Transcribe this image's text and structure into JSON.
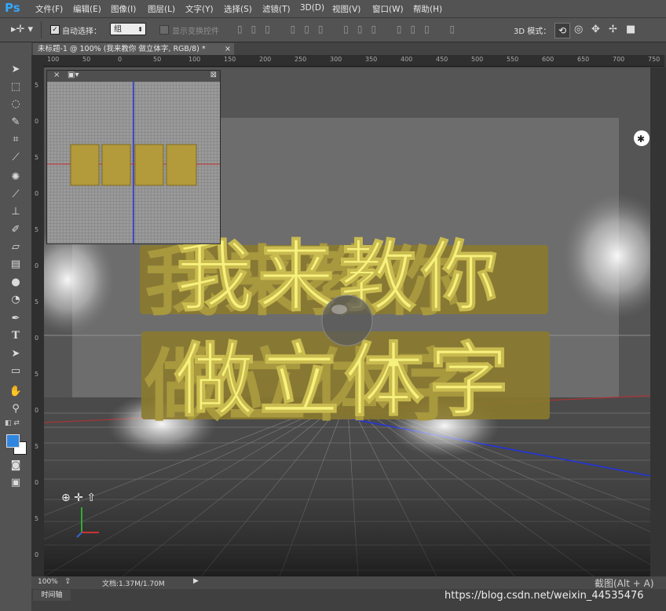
{
  "app": {
    "logo": "Ps"
  },
  "menus": [
    "文件(F)",
    "编辑(E)",
    "图像(I)",
    "图层(L)",
    "文字(Y)",
    "选择(S)",
    "滤镜(T)",
    "3D(D)",
    "视图(V)",
    "窗口(W)",
    "帮助(H)"
  ],
  "options": {
    "auto_select_label": "自动选择：",
    "auto_select_value": "组",
    "show_transform_label": "显示变换控件",
    "mode3d_label": "3D 模式："
  },
  "document_tab": {
    "title": "未标题-1 @ 100% (我来教你 做立体字, RGB/8) *",
    "close": "×"
  },
  "ruler_h": [
    "100",
    "50",
    "0",
    "50",
    "100",
    "150",
    "200",
    "250",
    "300",
    "350",
    "400",
    "450",
    "500",
    "550",
    "600",
    "650",
    "700",
    "750"
  ],
  "ruler_v": [
    "5",
    "0",
    "5",
    "0",
    "5",
    "0",
    "5",
    "0",
    "5",
    "0",
    "5",
    "0",
    "5",
    "0"
  ],
  "canvas_text": {
    "line1": "我来教你",
    "line2": "做立体字"
  },
  "status": {
    "zoom": "100%",
    "doc_size": "文档:1.37M/1.70M"
  },
  "timeline_label": "时间轴",
  "watermark": "https://blog.csdn.net/weixin_44535476",
  "screenshot_hint": "截图(Alt + A)",
  "colors": {
    "foreground": "#2f86e0",
    "background": "#ffffff",
    "extrude": "#8a7a2e",
    "face": "#f4ee7a"
  }
}
